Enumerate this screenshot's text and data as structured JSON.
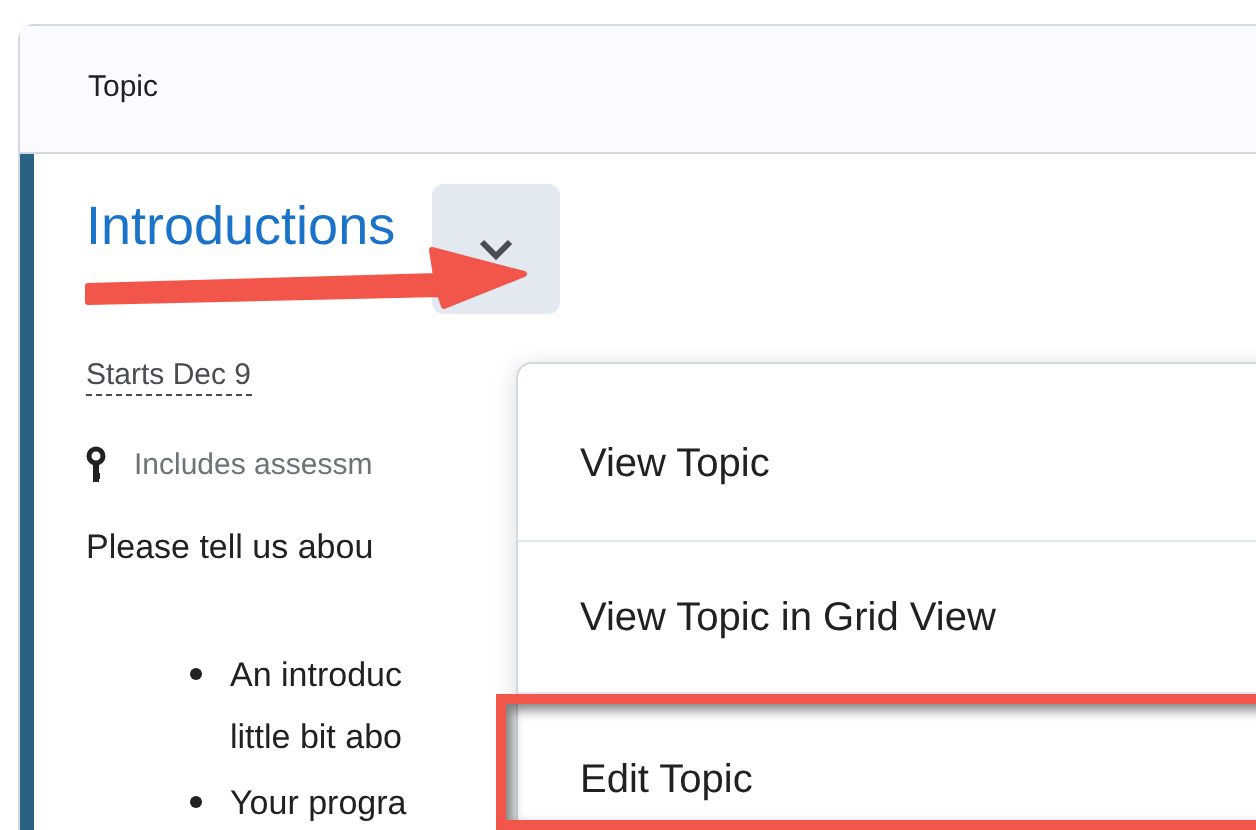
{
  "header": {
    "label": "Topic"
  },
  "topic": {
    "title": "Introductions",
    "starts": "Starts Dec 9",
    "assessment": "Includes assessm",
    "intro": "Please tell us abou",
    "bullets": [
      {
        "lines": [
          "An introduc",
          "little bit abo"
        ]
      },
      {
        "lines": [
          "Your progra"
        ]
      }
    ]
  },
  "menu": {
    "items": [
      {
        "label": "View Topic",
        "highlighted": false
      },
      {
        "label": "View Topic in Grid View",
        "highlighted": false
      },
      {
        "label": "Edit Topic",
        "highlighted": true
      }
    ]
  }
}
